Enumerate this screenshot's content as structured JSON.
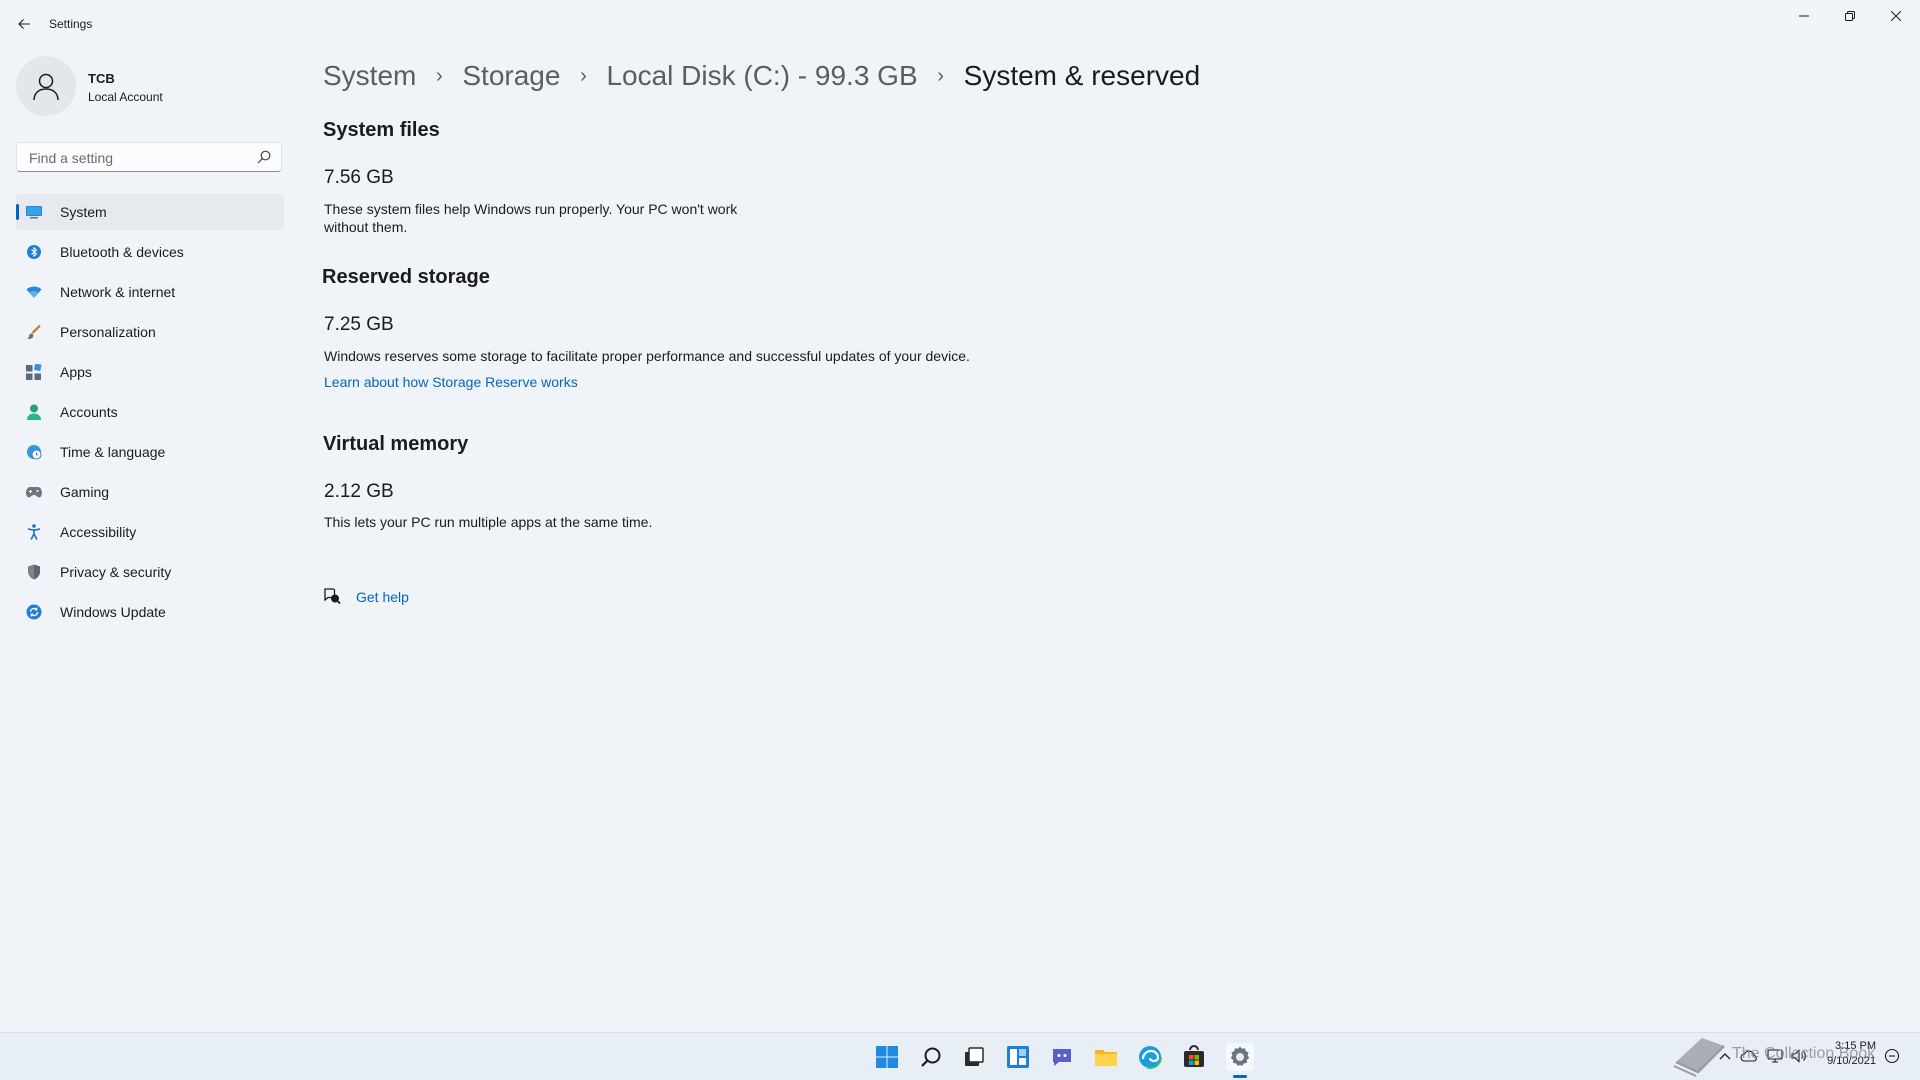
{
  "window": {
    "title": "Settings",
    "back_icon": "arrow-left-icon",
    "controls": [
      "minimize-icon",
      "restore-icon",
      "close-icon"
    ]
  },
  "profile": {
    "name": "TCB",
    "account_type": "Local Account",
    "icon": "person-icon"
  },
  "search": {
    "placeholder": "Find a setting",
    "icon": "search-icon"
  },
  "sidebar": {
    "items": [
      {
        "label": "System",
        "icon": "monitor-icon",
        "selected": true
      },
      {
        "label": "Bluetooth & devices",
        "icon": "bluetooth-icon"
      },
      {
        "label": "Network & internet",
        "icon": "wifi-icon"
      },
      {
        "label": "Personalization",
        "icon": "brush-icon"
      },
      {
        "label": "Apps",
        "icon": "apps-icon"
      },
      {
        "label": "Accounts",
        "icon": "person-icon"
      },
      {
        "label": "Time & language",
        "icon": "globe-clock-icon"
      },
      {
        "label": "Gaming",
        "icon": "gamepad-icon"
      },
      {
        "label": "Accessibility",
        "icon": "accessibility-icon"
      },
      {
        "label": "Privacy & security",
        "icon": "shield-icon"
      },
      {
        "label": "Windows Update",
        "icon": "update-icon"
      }
    ]
  },
  "breadcrumb": {
    "items": [
      "System",
      "Storage",
      "Local Disk (C:) - 99.3 GB"
    ],
    "current": "System & reserved",
    "separator": "›"
  },
  "sections": {
    "system_files": {
      "title": "System files",
      "size": "7.56 GB",
      "description": "These system files help Windows run properly. Your PC won't work without them."
    },
    "reserved_storage": {
      "title": "Reserved storage",
      "size": "7.25 GB",
      "description": "Windows reserves some storage to facilitate proper performance and successful updates of your device.",
      "link": "Learn about how Storage Reserve works"
    },
    "virtual_memory": {
      "title": "Virtual memory",
      "size": "2.12 GB",
      "description": "This lets your PC run multiple apps at the same time."
    }
  },
  "help": {
    "label": "Get help",
    "icon": "help-chat-icon"
  },
  "taskbar": {
    "apps": [
      "windows-start-icon",
      "search-icon",
      "task-view-icon",
      "widgets-icon",
      "chat-icon",
      "file-explorer-icon",
      "edge-icon",
      "store-icon",
      "settings-icon"
    ],
    "active_app": "settings-icon",
    "tray": [
      "chevron-up-icon",
      "cloud-icon",
      "network-icon",
      "volume-icon"
    ],
    "time": "3:15 PM",
    "date": "9/10/2021",
    "watermark": "The Collection Book"
  },
  "colors": {
    "accent": "#0067c0",
    "background": "#f0f4f9"
  }
}
